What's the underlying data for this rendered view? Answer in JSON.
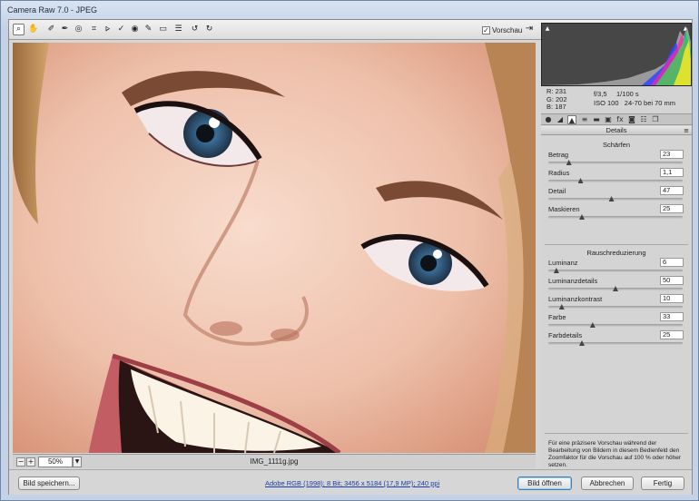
{
  "window": {
    "title": "Camera Raw 7.0 - JPEG"
  },
  "toolbar": {
    "tools": [
      "zoom-tool-icon",
      "hand-tool-icon",
      "white-balance-tool-icon",
      "color-sampler-tool-icon",
      "target-adjustment-tool-icon",
      "crop-tool-icon",
      "straighten-tool-icon",
      "spot-removal-tool-icon",
      "red-eye-removal-tool-icon",
      "adjustment-brush-icon",
      "graduated-filter-icon",
      "preferences-icon",
      "rotate-ccw-icon",
      "rotate-cw-icon"
    ],
    "preview_label": "Vorschau",
    "preview_checked": true
  },
  "image": {
    "filename": "IMG_1111g.jpg",
    "zoom": "50%"
  },
  "readout": {
    "r": "R:  231",
    "g": "G:  202",
    "b": "B:  187",
    "aperture_shutter": "f/3,5     1/100 s",
    "iso_lens": "ISO 100   24-70 bei 70 mm"
  },
  "panel": {
    "section": "Details",
    "sharpen": {
      "title": "Schärfen",
      "sliders": [
        {
          "label": "Betrag",
          "value": "23",
          "min": 0,
          "max": 150,
          "num": 23
        },
        {
          "label": "Radius",
          "value": "1,1",
          "min": 0.5,
          "max": 3,
          "num": 1.1
        },
        {
          "label": "Detail",
          "value": "47",
          "min": 0,
          "max": 100,
          "num": 47
        },
        {
          "label": "Maskieren",
          "value": "25",
          "min": 0,
          "max": 100,
          "num": 25
        }
      ]
    },
    "noise": {
      "title": "Rauschreduzierung",
      "sliders": [
        {
          "label": "Luminanz",
          "value": "6",
          "min": 0,
          "max": 100,
          "num": 6
        },
        {
          "label": "Luminanzdetails",
          "value": "50",
          "min": 0,
          "max": 100,
          "num": 50
        },
        {
          "label": "Luminanzkontrast",
          "value": "10",
          "min": 0,
          "max": 100,
          "num": 10
        },
        {
          "label": "Farbe",
          "value": "33",
          "min": 0,
          "max": 100,
          "num": 33
        },
        {
          "label": "Farbdetails",
          "value": "25",
          "min": 0,
          "max": 100,
          "num": 25
        }
      ]
    },
    "hint": "Für eine präzisere Vorschau während der Bearbeitung von Bildern in diesem Bedienfeld den Zoomfaktor für die Vorschau auf 100 % oder höher setzen."
  },
  "bottom": {
    "save": "Bild speichern...",
    "workflow": "Adobe RGB (1998); 8 Bit; 3456 x 5184 (17,9 MP); 240 ppi",
    "open": "Bild öffnen",
    "cancel": "Abbrechen",
    "done": "Fertig"
  }
}
